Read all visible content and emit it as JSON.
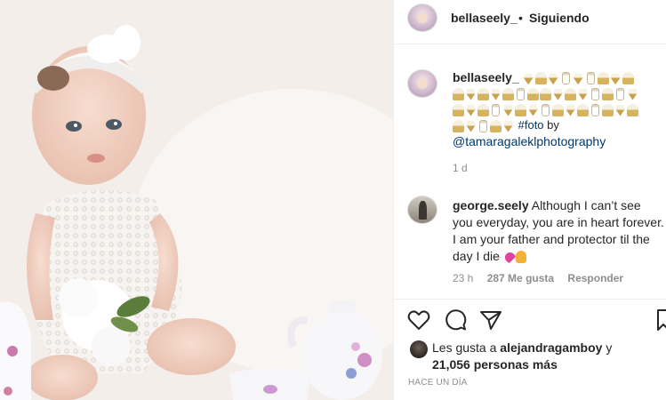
{
  "post": {
    "author": "bellaseely_",
    "separator": "•",
    "follow_status": "Siguiendo",
    "caption": {
      "hashtag": "#foto",
      "by_text": " by",
      "mention": "@tamaragaleklphotography",
      "time": "1 d",
      "emoji_icons": [
        "ice-cream-icon",
        "cupcake-icon",
        "baby-bottle-icon"
      ]
    },
    "comment": {
      "author": "george.seely",
      "text": "Although I can’t see you everyday, you are in heart forever. I am your father and protector til the day I die",
      "emoji_icons": [
        "two-hearts-icon",
        "praying-hands-icon"
      ],
      "time": "23 h",
      "likes": "287 Me gusta",
      "reply": "Responder"
    },
    "likes": {
      "prefix": "Les gusta a ",
      "first_user": "alejandragamboy",
      "conjunction": " y",
      "others": "21,056 personas más"
    },
    "posted_ago": "HACE UN DÍA"
  },
  "icons": {
    "like": "heart-outline-icon",
    "comment": "comment-bubble-icon",
    "share": "paper-plane-icon",
    "save": "bookmark-icon"
  },
  "colors": {
    "link": "#00376b",
    "muted": "#8e8e8e",
    "text": "#262626",
    "border": "#efefef"
  }
}
